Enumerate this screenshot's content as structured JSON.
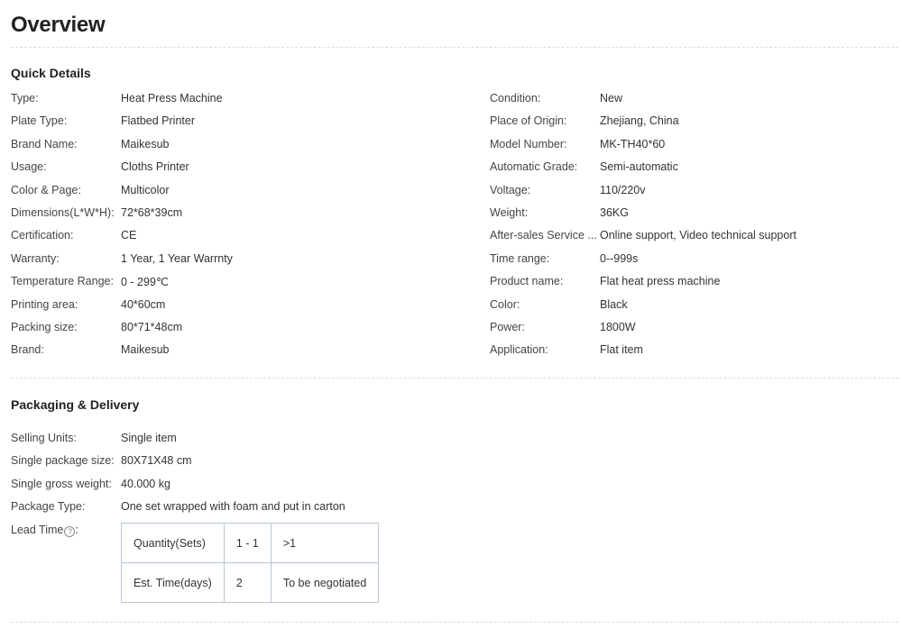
{
  "page_title": "Overview",
  "quick_details": {
    "title": "Quick Details",
    "left": [
      {
        "label": "Type:",
        "value": "Heat Press Machine"
      },
      {
        "label": "Plate Type:",
        "value": "Flatbed Printer"
      },
      {
        "label": "Brand Name:",
        "value": "Maikesub"
      },
      {
        "label": "Usage:",
        "value": "Cloths Printer"
      },
      {
        "label": "Color & Page:",
        "value": "Multicolor"
      },
      {
        "label": "Dimensions(L*W*H):",
        "value": "72*68*39cm"
      },
      {
        "label": "Certification:",
        "value": "CE"
      },
      {
        "label": "Warranty:",
        "value": "1 Year, 1 Year Warrnty"
      },
      {
        "label": "Temperature Range:",
        "value": "0 - 299℃"
      },
      {
        "label": "Printing area:",
        "value": "40*60cm"
      },
      {
        "label": "Packing size:",
        "value": "80*71*48cm"
      },
      {
        "label": "Brand:",
        "value": "Maikesub"
      }
    ],
    "right": [
      {
        "label": "Condition:",
        "value": "New"
      },
      {
        "label": "Place of Origin:",
        "value": "Zhejiang, China"
      },
      {
        "label": "Model Number:",
        "value": "MK-TH40*60"
      },
      {
        "label": "Automatic Grade:",
        "value": "Semi-automatic"
      },
      {
        "label": "Voltage:",
        "value": "110/220v"
      },
      {
        "label": "Weight:",
        "value": "36KG"
      },
      {
        "label": "After-sales Service ...",
        "value": "Online support, Video technical support"
      },
      {
        "label": "Time range:",
        "value": "0--999s"
      },
      {
        "label": "Product name:",
        "value": "Flat heat press machine"
      },
      {
        "label": "Color:",
        "value": "Black"
      },
      {
        "label": "Power:",
        "value": "1800W"
      },
      {
        "label": "Application:",
        "value": "Flat item"
      }
    ]
  },
  "packaging": {
    "title": "Packaging & Delivery",
    "rows": [
      {
        "label": "Selling Units:",
        "value": "Single item"
      },
      {
        "label": "Single package size:",
        "value": "80X71X48 cm"
      },
      {
        "label": "Single gross weight:",
        "value": "40.000 kg"
      },
      {
        "label": "Package Type:",
        "value": "One set wrapped with foam and put in carton"
      }
    ],
    "lead_time_label": "Lead Time",
    "lead_time_icon": "?",
    "lead_table": [
      [
        "Quantity(Sets)",
        "1 - 1",
        ">1"
      ],
      [
        "Est. Time(days)",
        "2",
        "To be negotiated"
      ]
    ]
  }
}
